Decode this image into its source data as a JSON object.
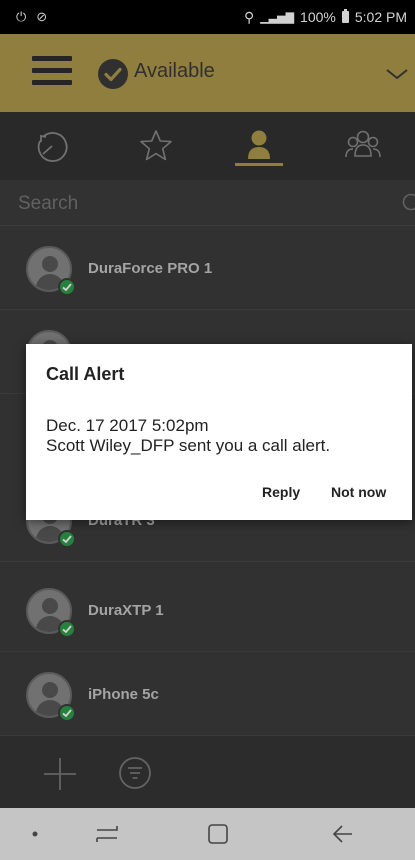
{
  "status_bar": {
    "left_icons": [
      "nfc-icon",
      "sync-icon"
    ],
    "battery": "100%",
    "time": "5:02 PM"
  },
  "header": {
    "presence": "Available",
    "accent_color": "#b09a4c"
  },
  "tabs": [
    {
      "name": "recent",
      "icon": "history-icon"
    },
    {
      "name": "favorites",
      "icon": "star-icon"
    },
    {
      "name": "contacts",
      "icon": "person-icon",
      "selected": true
    },
    {
      "name": "groups",
      "icon": "group-icon"
    }
  ],
  "search": {
    "placeholder": "Search"
  },
  "contacts": [
    {
      "name": "DuraForce PRO 1",
      "status": "online"
    },
    {
      "name": "",
      "status": "online"
    },
    {
      "name": "DuraTR 3",
      "status": "online"
    },
    {
      "name": "DuraXTP 1",
      "status": "online"
    },
    {
      "name": "iPhone 5c",
      "status": "online"
    }
  ],
  "dialog": {
    "title": "Call Alert",
    "line1": "Dec. 17 2017 5:02pm",
    "line2": "Scott Wiley_DFP sent you a call alert.",
    "reply": "Reply",
    "not_now": "Not now"
  },
  "colors": {
    "presence_online": "#2f9e4b",
    "list_background": "#3c3c3c"
  }
}
